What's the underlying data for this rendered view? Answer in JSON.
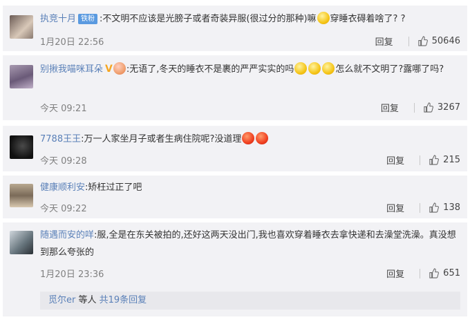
{
  "comments": [
    {
      "name": "执竞十月",
      "badge": "铁粉",
      "text_a": ":不文明不应该是光膀子或者奇装异服(很过分的那种)嘛",
      "text_b": "穿睡衣碍着啥了? ?",
      "time": "1月20日 22:56",
      "reply": "回复",
      "likes": "50646"
    },
    {
      "name": "别揪我喵咪耳朵",
      "text_a": ":无语了,冬天的睡衣不是裹的严严实实的吗",
      "text_b": "怎么就不文明了?露哪了吗?",
      "time": "今天 09:21",
      "reply": "回复",
      "likes": "3267"
    },
    {
      "name": "7788王王",
      "text_a": ":万一人家坐月子或者生病住院呢?没道理",
      "time": "今天 09:28",
      "reply": "回复",
      "likes": "215"
    },
    {
      "name": "健康顺利安",
      "text_a": ":矫枉过正了吧",
      "time": "今天 09:22",
      "reply": "回复",
      "likes": "138"
    },
    {
      "name": "随遇而安的咩",
      "text_a": ":服,全是在东关被拍的,还好这两天没出门,我也喜欢穿着睡衣去拿快递和去澡堂洗澡。真没想到那么夸张的",
      "time": "1月20日 23:36",
      "reply": "回复",
      "likes": "651",
      "more": {
        "name": "觅尔er",
        "mid": "等人",
        "count": "共19条回复"
      }
    }
  ]
}
